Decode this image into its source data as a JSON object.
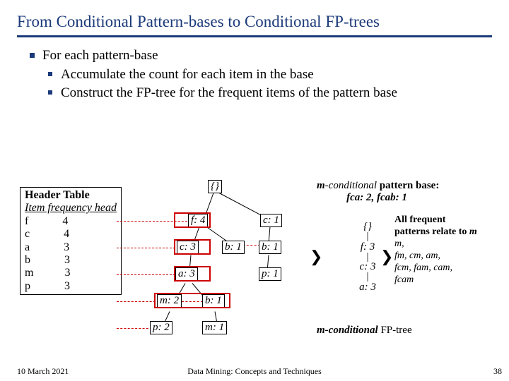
{
  "title": "From Conditional Pattern-bases to Conditional FP-trees",
  "bullets": {
    "b1": "For each pattern-base",
    "b2a": "Accumulate the count for each item in the base",
    "b2b": "Construct the FP-tree for the frequent items of the pattern base"
  },
  "header_table": {
    "title": "Header Table",
    "cols": "Item   frequency   head",
    "rows": [
      "f            4",
      "c            4",
      "a            3",
      "b            3",
      "m           3",
      "p            3"
    ]
  },
  "fp_tree": {
    "root": "{}",
    "nodes": {
      "f4": "f: 4",
      "c3": "c: 3",
      "a3": "a: 3",
      "m2": "m: 2",
      "b1a": "b: 1",
      "p2": "p: 2",
      "m1": "m: 1",
      "c1": "c: 1",
      "b1b": "b: 1",
      "b1c": "b: 1",
      "p1": "p: 1"
    }
  },
  "m_cond_base": {
    "label_prefix": "m",
    "label_suffix": "-conditional ",
    "label_bold": "pattern base:",
    "line2": "fca: 2, fcab: 1"
  },
  "m_tree": {
    "root": "{}",
    "f": "f: 3",
    "c": "c: 3",
    "a": "a: 3"
  },
  "all_freq": {
    "h1": "All frequent",
    "h2_a": "patterns relate to ",
    "h2_b": "m",
    "r1": "m,",
    "r2": "fm, cm, am,",
    "r3": "fcm, fam, cam,",
    "r4": "fcam"
  },
  "m_tree_label": {
    "i": "m-conditional",
    "rest": " FP-tree"
  },
  "arrows": {
    "a1": "❯",
    "a2": "❯"
  },
  "footer": {
    "date": "10 March 2021",
    "mid": "Data Mining: Concepts and Techniques",
    "num": "38"
  }
}
